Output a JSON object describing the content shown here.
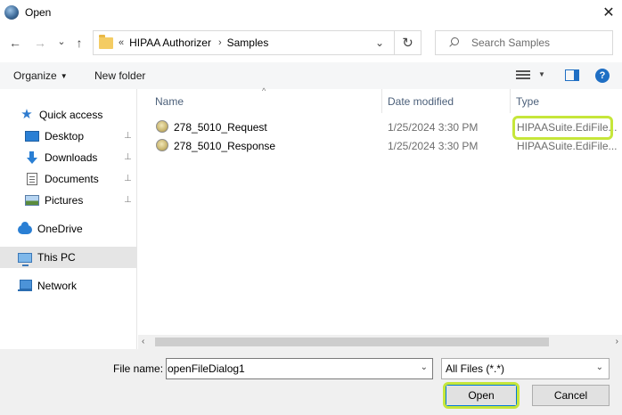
{
  "window": {
    "title": "Open",
    "close_glyph": "✕"
  },
  "nav": {
    "back_glyph": "←",
    "forward_glyph": "→",
    "recent_glyph": "⌄",
    "up_glyph": "↑",
    "breadcrumb": [
      "HIPAA Authorizer",
      "Samples"
    ],
    "overflow_glyph": "«",
    "sep_glyph": "›",
    "dropdown_glyph": "⌄",
    "refresh_glyph": "↻",
    "search_placeholder": "Search Samples"
  },
  "toolbar": {
    "organize_label": "Organize",
    "new_folder_label": "New folder",
    "help_glyph": "?"
  },
  "sidebar": {
    "items": [
      {
        "label": "Quick access",
        "icon": "star-icon",
        "pinned": false
      },
      {
        "label": "Desktop",
        "icon": "desktop-icon",
        "pinned": true
      },
      {
        "label": "Downloads",
        "icon": "downloads-icon",
        "pinned": true
      },
      {
        "label": "Documents",
        "icon": "documents-icon",
        "pinned": true
      },
      {
        "label": "Pictures",
        "icon": "pictures-icon",
        "pinned": true
      },
      {
        "label": "OneDrive",
        "icon": "cloud-icon",
        "pinned": false
      },
      {
        "label": "This PC",
        "icon": "computer-icon",
        "pinned": false,
        "selected": true
      },
      {
        "label": "Network",
        "icon": "network-icon",
        "pinned": false
      }
    ],
    "pin_glyph": "📌"
  },
  "filelist": {
    "columns": {
      "name": "Name",
      "date": "Date modified",
      "type": "Type"
    },
    "sort_glyph": "^",
    "rows": [
      {
        "name": "278_5010_Request",
        "date": "1/25/2024 3:30 PM",
        "type": "HIPAASuite.EdiFile..."
      },
      {
        "name": "278_5010_Response",
        "date": "1/25/2024 3:30 PM",
        "type": "HIPAASuite.EdiFile..."
      }
    ]
  },
  "scroll": {
    "left_glyph": "‹",
    "right_glyph": "›"
  },
  "bottom": {
    "filename_label": "File name:",
    "filename_value": "openFileDialog1",
    "filename_dropdown_glyph": "⌄",
    "filter_value": "All Files (*.*)",
    "filter_caret_glyph": "⌄",
    "open_label": "Open",
    "cancel_label": "Cancel"
  },
  "colors": {
    "highlight": "#c6e63a",
    "accent": "#0078d7"
  }
}
